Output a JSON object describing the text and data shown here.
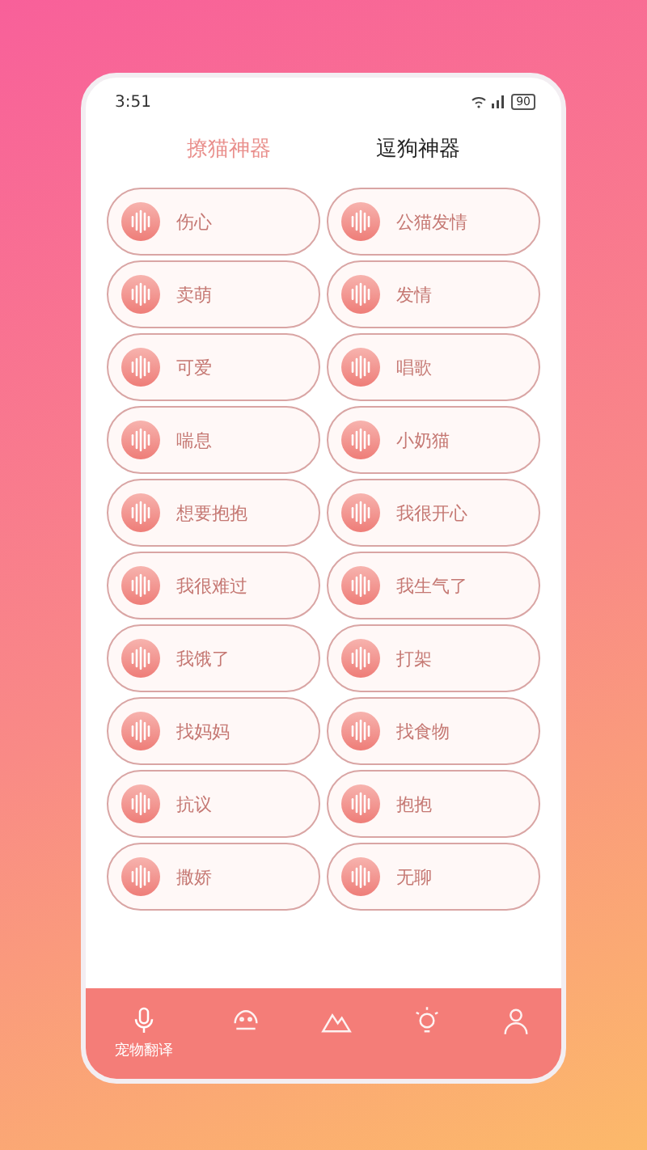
{
  "status_bar": {
    "time": "3:51",
    "battery": "90"
  },
  "tabs": [
    {
      "label": "撩猫神器",
      "selected": true
    },
    {
      "label": "逗狗神器",
      "selected": false
    }
  ],
  "sounds": [
    {
      "left": "伤心",
      "right": "公猫发情"
    },
    {
      "left": "卖萌",
      "right": "发情"
    },
    {
      "left": "可爱",
      "right": "唱歌"
    },
    {
      "left": "喘息",
      "right": "小奶猫"
    },
    {
      "left": "想要抱抱",
      "right": "我很开心"
    },
    {
      "left": "我很难过",
      "right": "我生气了"
    },
    {
      "left": "我饿了",
      "right": "打架"
    },
    {
      "left": "找妈妈",
      "right": "找食物"
    },
    {
      "left": "抗议",
      "right": "抱抱"
    },
    {
      "left": "撒娇",
      "right": "无聊"
    }
  ],
  "nav": [
    {
      "kind": "mic",
      "label": "宠物翻译",
      "selected": true
    },
    {
      "kind": "pet",
      "selected": false
    },
    {
      "kind": "mountain",
      "selected": false
    },
    {
      "kind": "bulb",
      "selected": false
    },
    {
      "kind": "person",
      "selected": false
    }
  ]
}
